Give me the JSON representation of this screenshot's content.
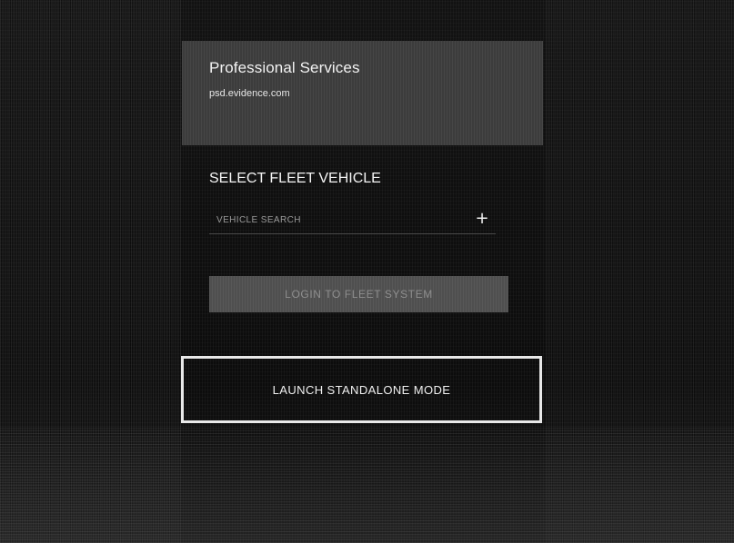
{
  "agency": {
    "name": "Professional Services",
    "domain": "psd.evidence.com"
  },
  "fleet": {
    "title": "SELECT FLEET VEHICLE",
    "search_placeholder": "VEHICLE SEARCH",
    "add_label": "+"
  },
  "actions": {
    "login_label": "LOGIN TO FLEET SYSTEM",
    "standalone_label": "LAUNCH STANDALONE MODE"
  }
}
